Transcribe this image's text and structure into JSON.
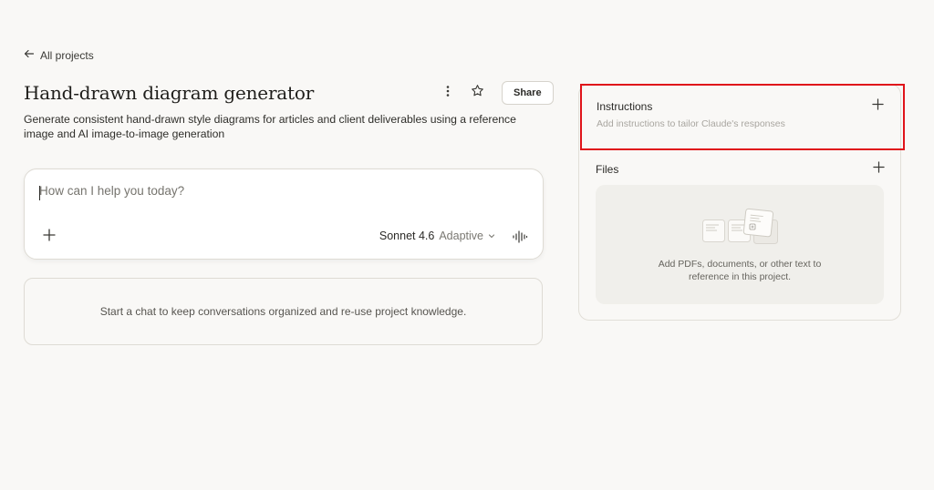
{
  "nav": {
    "back_label": "All projects"
  },
  "project": {
    "title": "Hand-drawn diagram generator",
    "description": "Generate consistent hand-drawn style diagrams for articles and client deliverables using a reference image and AI image-to-image generation",
    "share_label": "Share"
  },
  "chat": {
    "placeholder": "How can I help you today?",
    "model_name": "Sonnet 4.6",
    "model_mode": "Adaptive"
  },
  "conversations": {
    "empty_text": "Start a chat to keep conversations organized and re-use project knowledge."
  },
  "sidebar": {
    "instructions_title": "Instructions",
    "instructions_placeholder": "Add instructions to tailor Claude's responses",
    "files_title": "Files",
    "files_empty_line1": "Add PDFs, documents, or other text to",
    "files_empty_line2": "reference in this project."
  },
  "icons": {
    "back": "arrow-left-icon",
    "more": "more-vertical-icon",
    "star": "star-icon",
    "add": "plus-icon",
    "chevron": "chevron-down-icon",
    "voice": "waveform-icon"
  },
  "colors": {
    "background": "#f9f8f6",
    "highlight": "#e0141a",
    "panel_fill": "#f0efeb"
  }
}
